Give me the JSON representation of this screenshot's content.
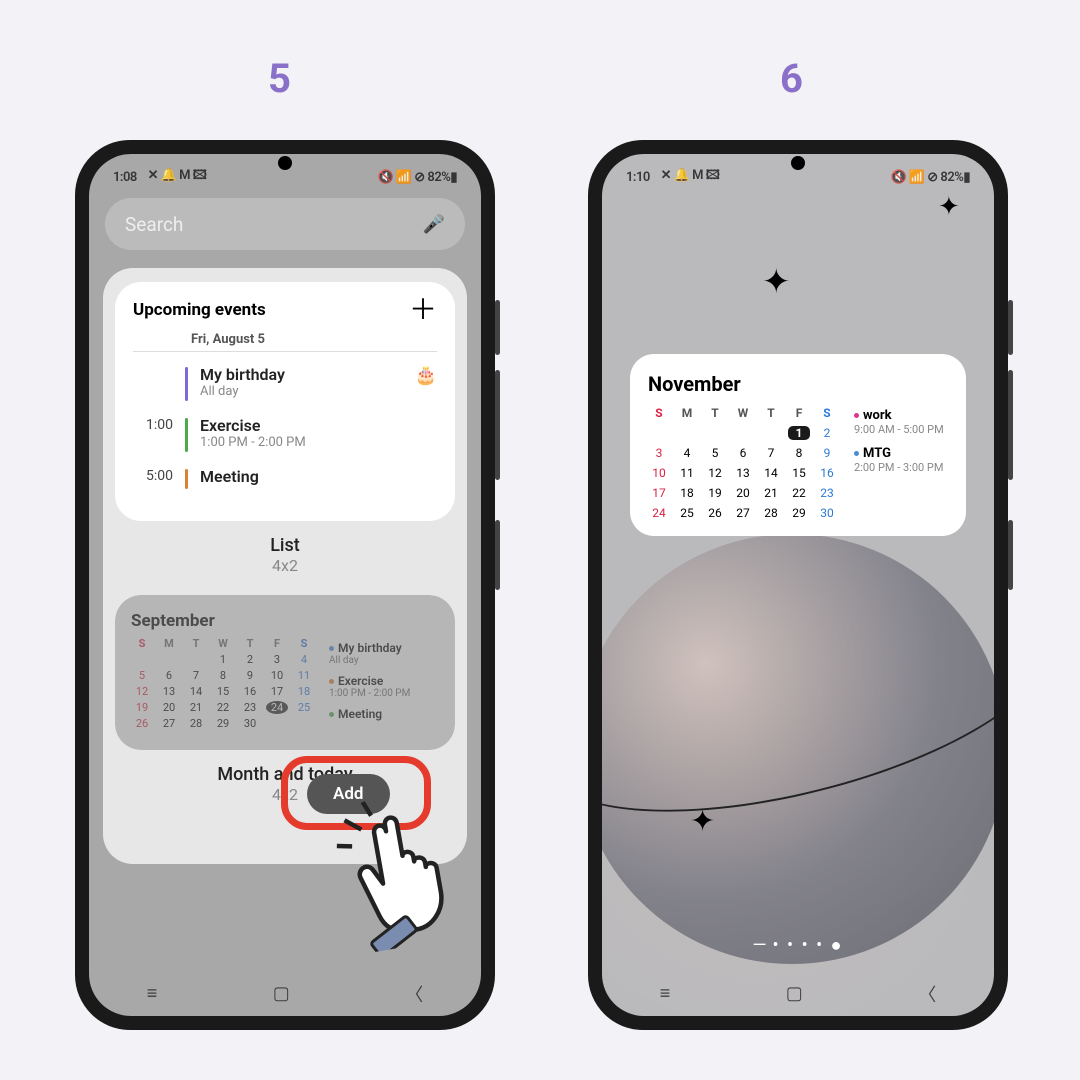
{
  "steps": {
    "s5": "5",
    "s6": "6"
  },
  "status_left": {
    "time": "1:08",
    "icons": "✕ 🔔 M 🖾",
    "right": "🔇 📶 ⊘ 82%▮"
  },
  "status_right": {
    "time": "1:10",
    "icons": "✕ 🔔 M 🖾",
    "right": "🔇 📶 ⊘ 82%▮"
  },
  "search": {
    "placeholder": "Search"
  },
  "upcoming": {
    "title": "Upcoming events",
    "date": "Fri, August 5",
    "events": [
      {
        "time": "",
        "title": "My birthday",
        "sub": "All day",
        "bar": "purple",
        "emoji": "🎂"
      },
      {
        "time": "1:00",
        "title": "Exercise",
        "sub": "1:00 PM - 2:00 PM",
        "bar": "green"
      },
      {
        "time": "5:00",
        "title": "Meeting",
        "sub": "",
        "bar": "orange"
      }
    ],
    "label": "List",
    "size": "4x2"
  },
  "month_preview": {
    "month": "September",
    "dow": [
      "S",
      "M",
      "T",
      "W",
      "T",
      "F",
      "S"
    ],
    "weeks": [
      [
        "",
        "",
        "",
        "1",
        "2",
        "3",
        "4"
      ],
      [
        "5",
        "6",
        "7",
        "8",
        "9",
        "10",
        "11"
      ],
      [
        "12",
        "13",
        "14",
        "15",
        "16",
        "17",
        "18"
      ],
      [
        "19",
        "20",
        "21",
        "22",
        "23",
        "24",
        "25"
      ],
      [
        "26",
        "27",
        "28",
        "29",
        "30",
        "",
        ""
      ]
    ],
    "today": "24",
    "events": [
      {
        "title": "My birthday",
        "sub": "All day",
        "color": "bl"
      },
      {
        "title": "Exercise",
        "sub": "1:00 PM - 2:00 PM",
        "color": "or"
      },
      {
        "title": "Meeting",
        "sub": "",
        "color": "gr"
      }
    ],
    "label": "Month and today",
    "size": "4x2"
  },
  "add_button": "Add",
  "home_cal": {
    "month": "November",
    "dow": [
      "S",
      "M",
      "T",
      "W",
      "T",
      "F",
      "S"
    ],
    "today": "1",
    "weeks": [
      [
        "",
        "",
        "",
        "",
        "",
        "1",
        "2"
      ],
      [
        "3",
        "4",
        "5",
        "6",
        "7",
        "8",
        "9"
      ],
      [
        "10",
        "11",
        "12",
        "13",
        "14",
        "15",
        "16"
      ],
      [
        "17",
        "18",
        "19",
        "20",
        "21",
        "22",
        "23"
      ],
      [
        "24",
        "25",
        "26",
        "27",
        "28",
        "29",
        "30"
      ]
    ],
    "events": [
      {
        "title": "work",
        "sub": "9:00 AM - 5:00 PM",
        "color": "pk"
      },
      {
        "title": "MTG",
        "sub": "2:00 PM - 3:00 PM",
        "color": "bl"
      }
    ]
  }
}
